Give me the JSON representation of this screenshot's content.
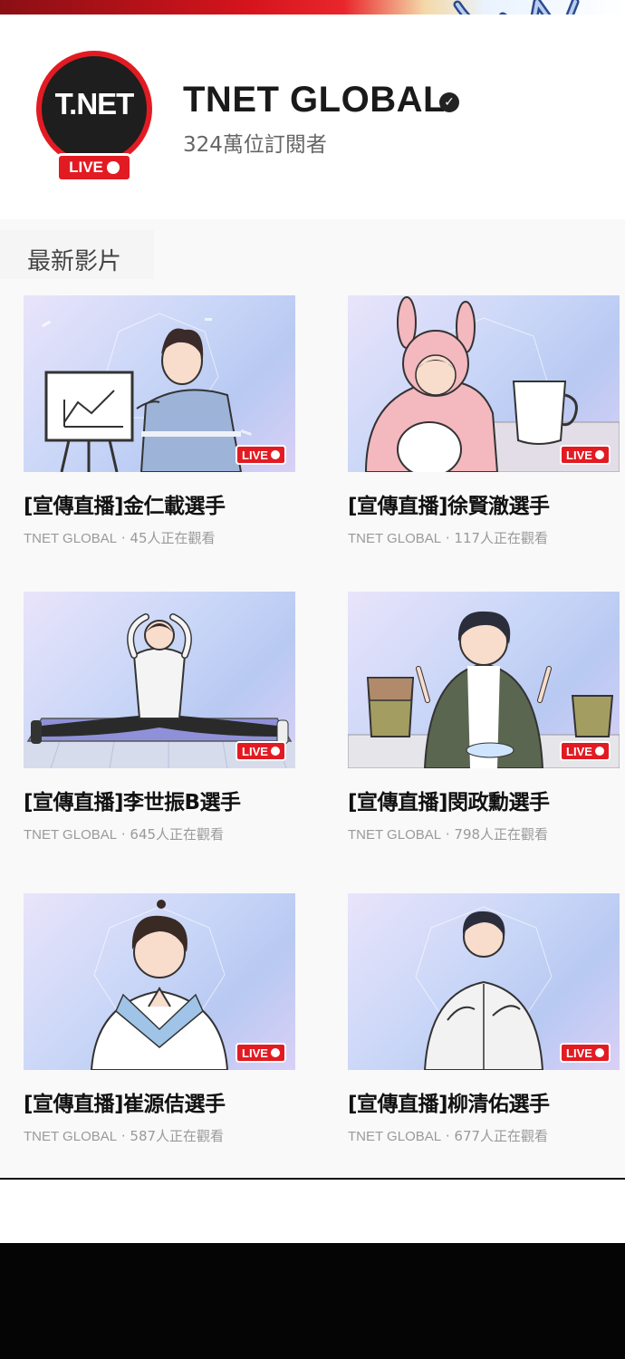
{
  "channel": {
    "logo_text": "T.NET",
    "logo_live": "LIVE",
    "name": "TNET GLOBAL",
    "subscribers": "324萬位訂閱者"
  },
  "section": {
    "title": "最新影片"
  },
  "live_badge": "LIVE",
  "videos": [
    {
      "title": "[宣傳直播]金仁載選手",
      "channel": "TNET GLOBAL",
      "viewers": "45人正在觀看"
    },
    {
      "title": "[宣傳直播]徐賢澈選手",
      "channel": "TNET GLOBAL",
      "viewers": "117人正在觀看"
    },
    {
      "title": "[宣傳直播]李世振B選手",
      "channel": "TNET GLOBAL",
      "viewers": "645人正在觀看"
    },
    {
      "title": "[宣傳直播]閔政勳選手",
      "channel": "TNET GLOBAL",
      "viewers": "798人正在觀看"
    },
    {
      "title": "[宣傳直播]崔源佶選手",
      "channel": "TNET GLOBAL",
      "viewers": "587人正在觀看"
    },
    {
      "title": "[宣傳直播]柳清佑選手",
      "channel": "TNET GLOBAL",
      "viewers": "677人正在觀看"
    }
  ],
  "colors": {
    "accent": "#e21b23",
    "logo_bg": "#1e1e1e",
    "meta_text": "#9a9a9a"
  }
}
